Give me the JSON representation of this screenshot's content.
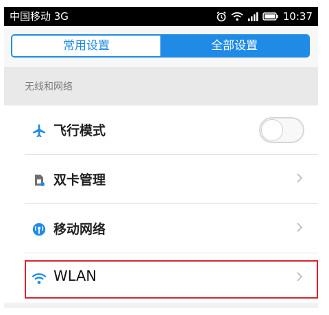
{
  "status_bar": {
    "carrier": "中国移动 3G",
    "time": "10:37",
    "icons": [
      "alarm-icon",
      "wifi-icon",
      "signal-icon",
      "battery-icon"
    ]
  },
  "tabs": [
    {
      "label": "常用设置",
      "active": false
    },
    {
      "label": "全部设置",
      "active": true
    }
  ],
  "section": {
    "title": "无线和网络"
  },
  "rows": [
    {
      "label": "飞行模式",
      "icon": "airplane-icon",
      "control": "toggle",
      "toggle_on": false
    },
    {
      "label": "双卡管理",
      "icon": "sim-card-icon",
      "control": "chevron"
    },
    {
      "label": "移动网络",
      "icon": "mobile-network-icon",
      "control": "chevron"
    },
    {
      "label": "WLAN",
      "icon": "wifi-icon",
      "control": "chevron",
      "highlighted": true
    }
  ],
  "colors": {
    "accent": "#1f8be6",
    "highlight_border": "#d9232d",
    "status_bar_bg": "#000000"
  }
}
